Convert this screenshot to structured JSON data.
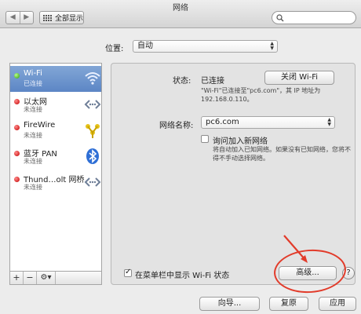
{
  "window": {
    "title": "网络",
    "nav_back": "◀",
    "nav_forward": "▶",
    "show_all": "全部显示",
    "search_placeholder": ""
  },
  "location": {
    "label": "位置:",
    "value": "自动"
  },
  "services": [
    {
      "name": "Wi-Fi",
      "status": "已连接",
      "state": "connected",
      "icon": "wifi-icon"
    },
    {
      "name": "以太网",
      "status": "未连接",
      "state": "disconnected",
      "icon": "ethernet-icon"
    },
    {
      "name": "FireWire",
      "status": "未连接",
      "state": "disconnected",
      "icon": "firewire-icon"
    },
    {
      "name": "蓝牙 PAN",
      "status": "未连接",
      "state": "disconnected",
      "icon": "bluetooth-icon"
    },
    {
      "name": "Thund…olt 网桥",
      "status": "未连接",
      "state": "disconnected",
      "icon": "thunderbolt-bridge-icon"
    }
  ],
  "sidebar_controls": {
    "add": "+",
    "remove": "−",
    "gear": "⚙▾"
  },
  "detail": {
    "status_label": "状态:",
    "status_value": "已连接",
    "turn_off_button": "关闭 Wi-Fi",
    "status_description": "\"Wi-Fi\"已连接至\"pc6.com\"，其 IP 地址为",
    "ip_address": "192.168.0.110。",
    "network_name_label": "网络名称:",
    "network_name_value": "pc6.com",
    "ask_join_label": "询问加入新网络",
    "ask_join_checked": false,
    "ask_join_note_1": "将自动加入已知网络。如果没有已知网络，您将不",
    "ask_join_note_2": "得不手动选择网络。",
    "show_menubar_label": "在菜单栏中显示 Wi-Fi 状态",
    "show_menubar_checked": true,
    "advanced_button": "高级...",
    "help_button": "?"
  },
  "footer": {
    "assist_button": "向导...",
    "revert_button": "复原",
    "apply_button": "应用"
  },
  "colors": {
    "selection": "#5c86c5",
    "annotation": "#e23b2a"
  }
}
